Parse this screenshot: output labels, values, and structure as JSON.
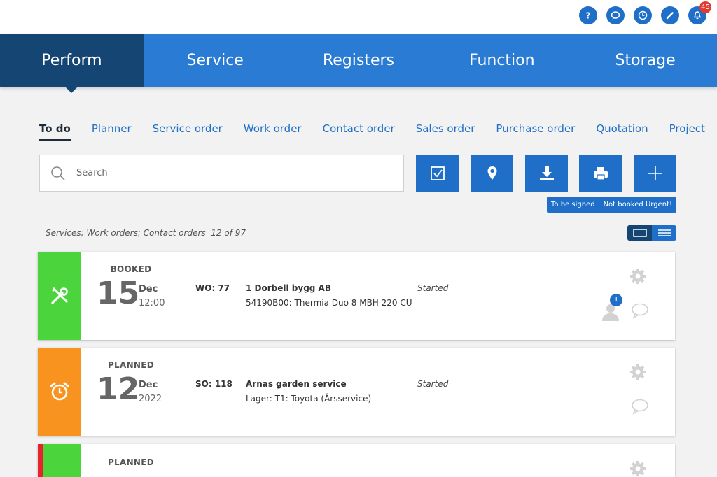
{
  "top_icons": {
    "help": "question-mark-icon",
    "chat": "chat-bubble-icon",
    "clock": "clock-icon",
    "pen": "pen-icon",
    "bell": "bell-icon",
    "notification_count": "45"
  },
  "main_nav": {
    "tabs": [
      {
        "label": "Perform",
        "active": true
      },
      {
        "label": "Service",
        "active": false
      },
      {
        "label": "Registers",
        "active": false
      },
      {
        "label": "Function",
        "active": false
      },
      {
        "label": "Storage",
        "active": false
      }
    ]
  },
  "sub_tabs": [
    {
      "label": "To do",
      "active": true
    },
    {
      "label": "Planner"
    },
    {
      "label": "Service order"
    },
    {
      "label": "Work order"
    },
    {
      "label": "Contact order"
    },
    {
      "label": "Sales order"
    },
    {
      "label": "Purchase order"
    },
    {
      "label": "Quotation"
    },
    {
      "label": "Project"
    }
  ],
  "search": {
    "placeholder": "Search",
    "value": ""
  },
  "actions": [
    "checkbox-icon",
    "map-pin-icon",
    "download-icon",
    "printer-icon",
    "plus-icon"
  ],
  "filters": {
    "to_be_signed": "To be signed",
    "not_booked_urgent": "Not booked Urgent!"
  },
  "list_summary": {
    "types": "Services; Work orders; Contact orders",
    "count": "12 of 97"
  },
  "colors": {
    "accent": "#1f6fc9",
    "nav": "#2a7bd3",
    "nav_active": "#154673",
    "green": "#4cd43c",
    "orange": "#f7931e",
    "urgent": "#e8232b"
  },
  "cards": [
    {
      "icon": "tools-icon",
      "strip_color": "#4cd43c",
      "status": "BOOKED",
      "day": "15",
      "month": "Dec",
      "time": "12:00",
      "order_no": "WO: 77",
      "customer": "1 Dorbell bygg AB",
      "description": "54190B00: Thermia Duo 8 MBH 220 CU",
      "state": "Started",
      "assignee_count": "1"
    },
    {
      "icon": "alarm-clock-icon",
      "strip_color": "#f7931e",
      "status": "PLANNED",
      "day": "12",
      "month": "Dec",
      "time": "2022",
      "order_no": "SO: 118",
      "customer": "Arnas garden service",
      "description": "Lager: T1: Toyota (Årsservice)",
      "state": "Started"
    },
    {
      "icon": "tools-icon",
      "strip_color": "#4cd43c",
      "urgent": true,
      "status": "PLANNED"
    }
  ]
}
